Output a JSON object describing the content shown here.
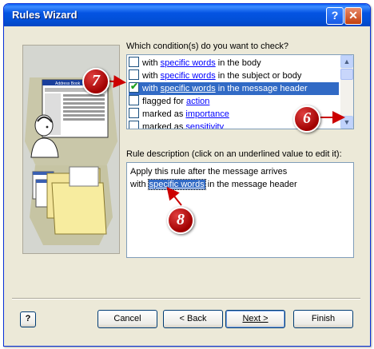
{
  "window": {
    "title": "Rules Wizard",
    "help_glyph": "?",
    "close_glyph": "✕"
  },
  "conditions": {
    "label": "Which condition(s) do you want to check?",
    "rows": [
      {
        "pre": "with ",
        "link": "specific words",
        "post": " in the body",
        "checked": false,
        "selected": false
      },
      {
        "pre": "with ",
        "link": "specific words",
        "post": " in the subject or body",
        "checked": false,
        "selected": false
      },
      {
        "pre": "with ",
        "link": "specific words",
        "post": " in the message header",
        "checked": true,
        "selected": true
      },
      {
        "pre": "flagged for ",
        "link": "action",
        "post": "",
        "checked": false,
        "selected": false
      },
      {
        "pre": "marked as ",
        "link": "importance",
        "post": "",
        "checked": false,
        "selected": false
      },
      {
        "pre": "marked as ",
        "link": "sensitivity",
        "post": "",
        "checked": false,
        "selected": false
      }
    ]
  },
  "description": {
    "label": "Rule description (click on an underlined value to edit it):",
    "line1": "Apply this rule after the message arrives",
    "line2_pre": "with ",
    "line2_link": "specific words",
    "line2_post": " in the message header"
  },
  "buttons": {
    "help": "?",
    "cancel": "Cancel",
    "back": "< Back",
    "next": "Next >",
    "finish": "Finish"
  },
  "callouts": {
    "six": "6",
    "seven": "7",
    "eight": "8"
  },
  "illustration": {
    "window_caption": "Address Book"
  },
  "colors": {
    "selection": "#316ac5",
    "titlebar": "#0454e3",
    "callout": "#c00000",
    "arrow": "#cc0000"
  }
}
